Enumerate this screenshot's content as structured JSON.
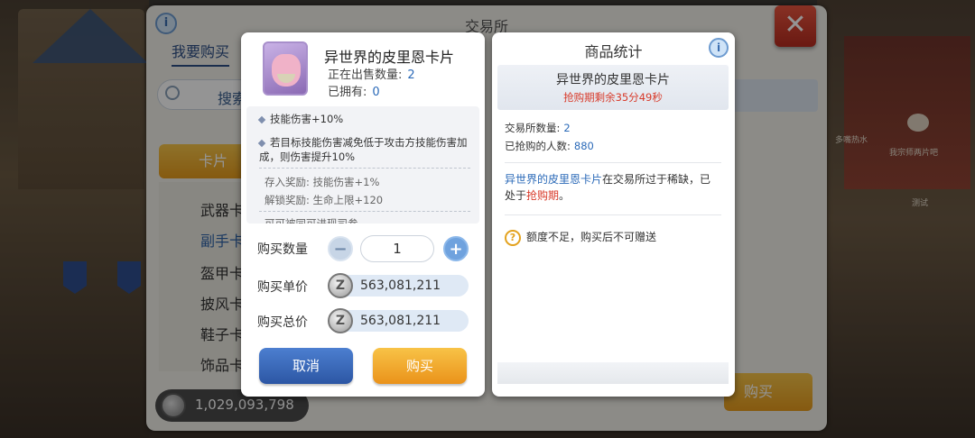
{
  "background": {
    "npc_labels": [
      "多嘴热水",
      "我宗师两片吧",
      "测试"
    ]
  },
  "exchange": {
    "title": "交易所",
    "info_icon": "i",
    "close_icon": "✕",
    "tab_buy": "我要购买",
    "search_label": "搜索",
    "category_button": "卡片",
    "categories": [
      "武器卡",
      "副手卡",
      "盔甲卡",
      "披风卡",
      "鞋子卡",
      "饰品卡"
    ],
    "money": "1,029,093,798",
    "buy_bg_label": "购买"
  },
  "dialog": {
    "item_name": "异世界的皮里恩卡片",
    "on_sale_label": "正在出售数量:",
    "on_sale_value": "2",
    "owned_label": "已拥有:",
    "owned_value": "0",
    "desc": {
      "line1": "技能伤害+10%",
      "line2": "若目标技能伤害减免低于攻击方技能伤害加成，则伤害提升10%",
      "deposit": "存入奖励: 技能伤害+1%",
      "unlock": "解锁奖励: 生命上限+120",
      "cutoff": "可可被同可进现司参"
    },
    "qty_label": "购买数量",
    "qty_value": "1",
    "minus": "−",
    "plus": "+",
    "unit_price_label": "购买单价",
    "unit_price": "563,081,211",
    "total_price_label": "购买总价",
    "total_price": "563,081,211",
    "coin_glyph": "Z",
    "cancel": "取消",
    "buy": "购买"
  },
  "stats": {
    "title": "商品统计",
    "info_icon": "i",
    "item_name": "异世界的皮里恩卡片",
    "timer": "抢购期剩余35分49秒",
    "exchange_count_label": "交易所数量:",
    "exchange_count": "2",
    "buyers_label": "已抢购的人数:",
    "buyers": "880",
    "msg_item": "异世界的皮里恩卡片",
    "msg_mid": "在交易所过于稀缺，已处于",
    "msg_period": "抢购期",
    "msg_end": "。",
    "warn_icon": "?",
    "warning": "额度不足，购买后不可赠送"
  }
}
